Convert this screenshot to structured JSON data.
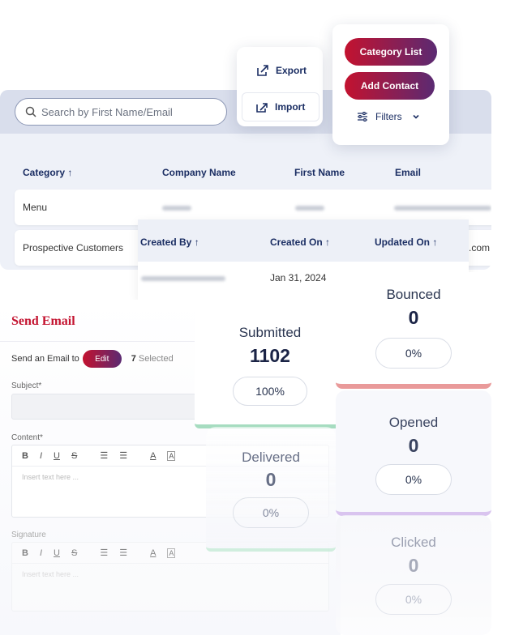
{
  "search": {
    "placeholder": "Search by First Name/Email"
  },
  "actions": {
    "export_label": "Export",
    "import_label": "Import",
    "category_list_label": "Category List",
    "add_contact_label": "Add Contact",
    "filters_label": "Filters"
  },
  "table": {
    "columns": [
      "Category ↑",
      "Company Name",
      "First Name",
      "Email"
    ],
    "rows": [
      {
        "category": "Menu"
      },
      {
        "category": "Prospective Customers",
        "email_suffix": ".com"
      }
    ]
  },
  "table2": {
    "columns": [
      "Created By ↑",
      "Created On ↑",
      "Updated On ↑"
    ],
    "rows": [
      {
        "created_on": "Jan 31, 2024"
      }
    ]
  },
  "email": {
    "title": "Send Email",
    "send_to_label": "Send an Email to",
    "edit_label": "Edit",
    "selected_count": "7",
    "selected_label": "Selected",
    "subject_label": "Subject*",
    "content_label": "Content*",
    "content_placeholder": "Insert text here ...",
    "signature_label": "Signature",
    "signature_placeholder": "Insert text here ...",
    "toolbar": [
      "B",
      "I",
      "U",
      "S",
      "☰",
      "☰",
      "A",
      "A"
    ]
  },
  "stats": {
    "submitted": {
      "title": "Submitted",
      "value": "1102",
      "percent": "100%"
    },
    "delivered": {
      "title": "Delivered",
      "value": "0",
      "percent": "0%"
    },
    "bounced": {
      "title": "Bounced",
      "value": "0",
      "percent": "0%"
    },
    "opened": {
      "title": "Opened",
      "value": "0",
      "percent": "0%"
    },
    "clicked": {
      "title": "Clicked",
      "value": "0",
      "percent": "0%"
    }
  },
  "colors": {
    "accent_red": "#c3122f",
    "accent_purple": "#5b2a72",
    "bounced_bar": "#e99a9a",
    "submitted_bar": "#a6dcc0",
    "opened_bar": "#d9c4ef"
  }
}
